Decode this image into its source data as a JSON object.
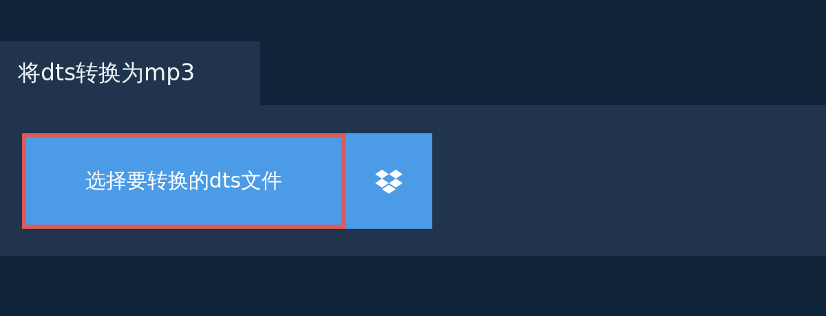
{
  "tab": {
    "label": "将dts转换为mp3",
    "selected": true
  },
  "choose_button": {
    "label": "选择要转换的dts文件",
    "focused": true
  }
}
